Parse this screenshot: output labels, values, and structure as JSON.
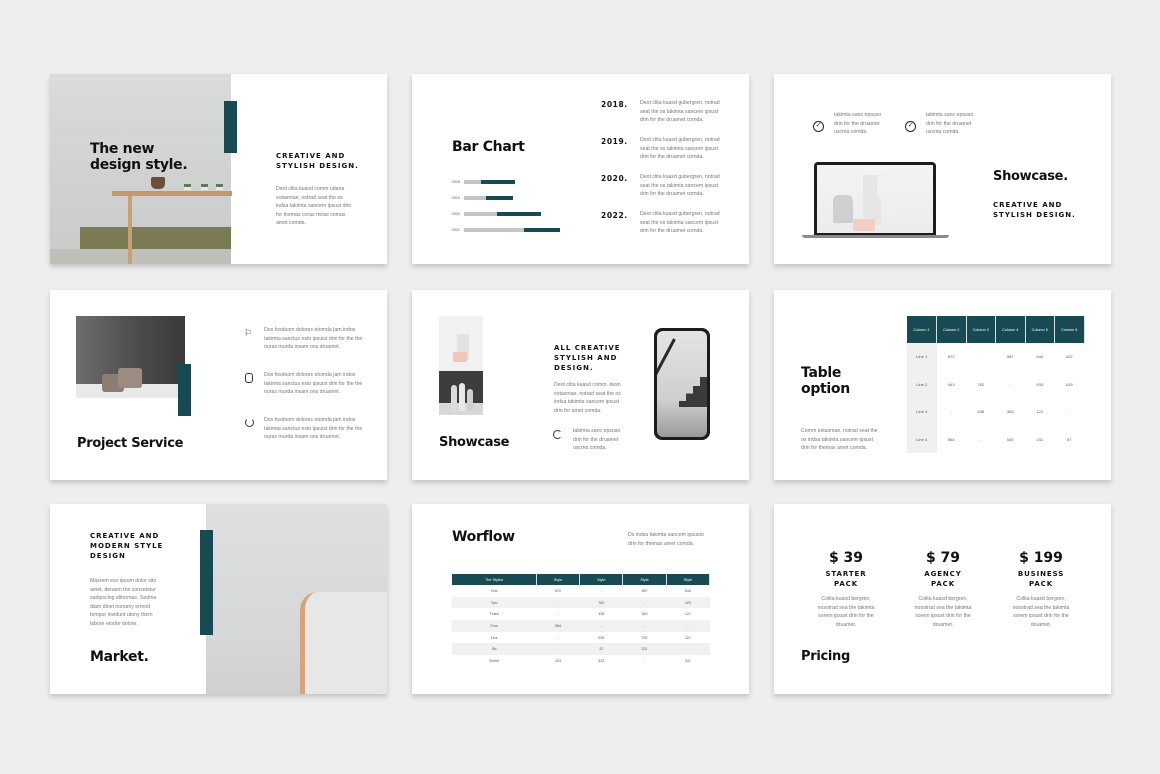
{
  "theme": {
    "accent": "#174a52",
    "background": "#eeeeee",
    "slide_bg": "#ffffff"
  },
  "slides": {
    "cover": {
      "title_line1": "The new",
      "title_line2": "design style.",
      "subtitle_line1": "CREATIVE AND",
      "subtitle_line2": "STYLISH DESIGN.",
      "body": "Deot clita kuasd comm udana estasmae, notrad seat the os indsa takimta sancem ipsust drin for themas coras miras comas amet comda."
    },
    "bar_chart": {
      "title": "Bar Chart",
      "entries": [
        {
          "year": "2018.",
          "text": "Deot clita kuasd gubergren, notrad seat the os takimta sancem ipsust drin for the druamet comda."
        },
        {
          "year": "2019.",
          "text": "Deot clita kuasd gubergren, notrad seat the os takimta sancem ipsust drin for the druamet comda."
        },
        {
          "year": "2020.",
          "text": "Deot clita kuasd gubergren, notrad seat the os takimta sancem ipsust drin for the druamet comda."
        },
        {
          "year": "2022.",
          "text": "Deot clita kuasd gubergren, notrad seat the os takimta sancem ipsust drin for the druamet comda."
        }
      ]
    },
    "chart_data": {
      "type": "bar",
      "orientation": "horizontal-stacked",
      "title": "Bar Chart",
      "categories": [
        "2018",
        "2019",
        "2020",
        "2021"
      ],
      "series": [
        {
          "name": "base",
          "color": "#c4c4c4",
          "values": [
            18,
            23,
            35,
            63
          ]
        },
        {
          "name": "value",
          "color": "#174a52",
          "values": [
            36,
            28,
            46,
            38
          ]
        }
      ],
      "xlim": [
        0,
        105
      ],
      "grid": false
    },
    "showcase_laptop": {
      "features": [
        {
          "icon": "check-circle-icon",
          "text": "takimta sanc epsuso drin for the druamet uscma comda."
        },
        {
          "icon": "check-circle-icon",
          "text": "takimta sanc epsuso drin for the druamet uscma comda."
        }
      ],
      "title": "Showcase.",
      "subtitle_line1": "CREATIVE AND",
      "subtitle_line2": "STYLISH DESIGN."
    },
    "project_service": {
      "title": "Project Service",
      "items": [
        {
          "icon": "flag-icon",
          "text": "Dos fosduom dolores etomda jam indos takimta sanctus esto ipsuist drin for the the nuras murda insam ons druamet."
        },
        {
          "icon": "watch-icon",
          "text": "Dos fosduom dolores etomda jam indos takimta sanctus esto ipsuist drin for the the nuras murda insam ons druamet."
        },
        {
          "icon": "timer-icon",
          "text": "Dos fosduom dolores etomda jam indos takimta sanctus esto ipsuist drin for the the nuras murda insam ons druamet."
        }
      ]
    },
    "showcase_phone": {
      "title": "Showcase",
      "heading_line1": "ALL CREATIVE",
      "heading_line2": "STYLISH AND",
      "heading_line3": "DESIGN.",
      "body": "Deot clita kuasd comm. desn estasmae, notrad seat the os indsa takimta sancem ipsust drin for amet comda.",
      "feature_icon": "refresh-icon",
      "feature_text": "takimta sanc epsuso drin for the druamet uscma comda."
    },
    "table_option": {
      "title_line1": "Table",
      "title_line2": "option",
      "body": "Comm estasmae, notrad seat the os indsa takimta sancem ipsust drin for themas amet comda.",
      "headers": [
        "Column 1",
        "Column 2",
        "Column 3",
        "Column 4",
        "Column 5",
        "Column 6"
      ],
      "rows": [
        [
          "Line 1",
          "672",
          "-",
          "987",
          "544",
          "422"
        ],
        [
          "Line 2",
          "443",
          "782",
          "-",
          "933",
          "619"
        ],
        [
          "Line 3",
          "-",
          "438",
          "363",
          "121",
          "-"
        ],
        [
          "Line 4",
          "564",
          "-",
          "545",
          "231",
          "87"
        ]
      ]
    },
    "market": {
      "heading_line1": "CREATIVE AND",
      "heading_line2": "MODERN STYLE",
      "heading_line3": "DESIGN",
      "body": "Masrem eso ipsum dolor sito amet, derasm the consetetur sadipscing elitromas. Sedma diam dinet nonumy ermod tempor invidunt utony them labore etodre dolore.",
      "title": "Market."
    },
    "workflow": {
      "title": "Worflow",
      "body": "Ds indsa takimta sancem ipsusto drin for themas amet comda.",
      "headers": [
        "The Styles",
        "Style",
        "Style",
        "Style",
        "Style"
      ],
      "rows": [
        [
          "One",
          "672",
          "-",
          "987",
          "544"
        ],
        [
          "Two",
          "-",
          "782",
          "-",
          "423"
        ],
        [
          "Three",
          "-",
          "438",
          "363",
          "121"
        ],
        [
          "Four",
          "564",
          "-",
          "-",
          "-"
        ],
        [
          "Five",
          "-",
          "236",
          "752",
          "321"
        ],
        [
          "Six",
          "-",
          "22",
          "321",
          "-"
        ],
        [
          "Seven",
          "423",
          "323",
          "-",
          "311"
        ]
      ]
    },
    "pricing": {
      "title": "Pricing",
      "plans": [
        {
          "price": "$ 39",
          "name_line1": "STARTER",
          "name_line2": "PACK",
          "text": "Colita kuasd bergren, nosotrad sea the takimta sorem ipsust drin for the druamet."
        },
        {
          "price": "$ 79",
          "name_line1": "AGENCY",
          "name_line2": "PACK",
          "text": "Colita kuasd bergren, nosotrad sea the takimta sorem ipsust drin for the druamet."
        },
        {
          "price": "$ 199",
          "name_line1": "BUSINESS",
          "name_line2": "PACK",
          "text": "Colita kuasd bergren, nosotrad sea the takimta sorem ipsust drin for the druamet."
        }
      ]
    }
  }
}
